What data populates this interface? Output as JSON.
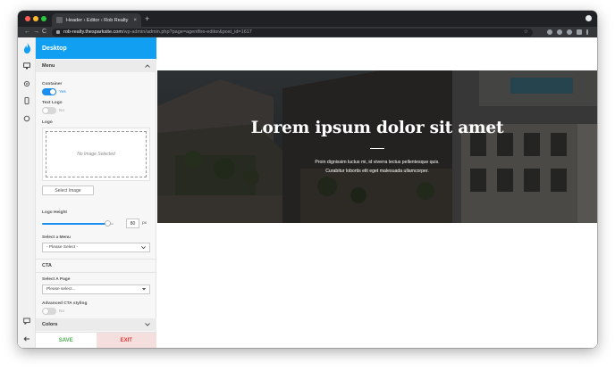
{
  "browser": {
    "tab_title": "Header ‹ Editor ‹ Rob Realty",
    "tab_close": "×",
    "new_tab": "+",
    "url_host": "rob-realty.thesparksite.com",
    "url_path": "/wp-admin/admin.php?page=agentfire-editor&post_id=1617",
    "back": "←",
    "forward": "→",
    "reload": "C",
    "star": "☆"
  },
  "rail": {
    "icons": [
      "flame-logo",
      "desktop-icon",
      "gear-icon",
      "tablet-icon",
      "circle-icon",
      "comment-icon",
      "back-arrow-icon"
    ]
  },
  "panel": {
    "header": "Desktop",
    "menu_section": "Menu",
    "container_label": "Container",
    "container_value": "Yes",
    "text_logo_label": "Text Logo",
    "text_logo_value": "No",
    "logo_label": "Logo",
    "logo_placeholder": "No Image Selected",
    "select_image": "Select Image",
    "logo_height_label": "Logo Height",
    "logo_height_value": "80",
    "logo_height_unit": "px",
    "logo_height_fraction": 0.92,
    "select_menu_label": "Select a Menu",
    "select_menu_value": "- Please Select -",
    "cta_section": "CTA",
    "select_page_label": "Select A Page",
    "select_page_value": "Please select...",
    "advanced_cta_label": "Advanced CTA styling",
    "advanced_cta_value": "No",
    "colors_section": "Colors",
    "save": "SAVE",
    "exit": "EXIT"
  },
  "hero": {
    "title": "Lorem ipsum dolor sit amet",
    "line1": "Proin dignissim luctus mi, id viverra lectus pellentesque quis.",
    "line2": "Curabitur lobortis elit eget malesuada ullamcorper."
  },
  "colors": {
    "accent": "#109ff1",
    "toggle_on": "#1a8ff0",
    "save": "#4caf50",
    "exit": "#e53935"
  }
}
